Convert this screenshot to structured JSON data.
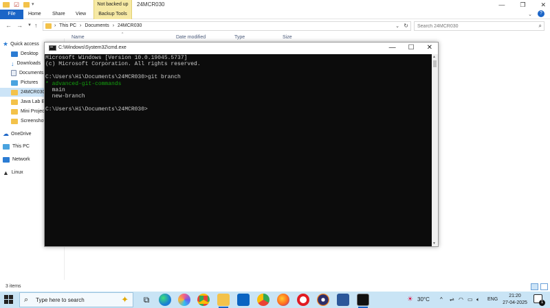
{
  "explorer": {
    "title": "24MCR030",
    "not_backed_up": "Not backed up",
    "ribbon_tabs": {
      "file": "File",
      "home": "Home",
      "share": "Share",
      "view": "View",
      "backup_tools": "Backup Tools"
    },
    "breadcrumb": [
      "This PC",
      "Documents",
      "24MCR030"
    ],
    "search_placeholder": "Search 24MCR030",
    "columns": {
      "name": "Name",
      "date_modified": "Date modified",
      "type": "Type",
      "size": "Size"
    },
    "nav_items": [
      {
        "label": "Quick access",
        "icon": "star-icon",
        "color": "#2b7cd3"
      },
      {
        "label": "Desktop",
        "icon": "desktop-icon",
        "color": "#2b7cd3"
      },
      {
        "label": "Downloads",
        "icon": "download-icon",
        "color": "#2b7cd3"
      },
      {
        "label": "Documents",
        "icon": "document-icon",
        "color": "#7a8aa8"
      },
      {
        "label": "Pictures",
        "icon": "picture-icon",
        "color": "#4aa3df"
      },
      {
        "label": "24MCR030",
        "icon": "folder-icon",
        "color": "#f3c24a"
      },
      {
        "label": "Java Lab Ex",
        "icon": "folder-icon",
        "color": "#f3c24a"
      },
      {
        "label": "Mini Projec",
        "icon": "folder-icon",
        "color": "#f3c24a"
      },
      {
        "label": "Screenshot",
        "icon": "folder-icon",
        "color": "#f3c24a"
      },
      {
        "label": "OneDrive",
        "icon": "cloud-icon",
        "color": "#1b65c7"
      },
      {
        "label": "This PC",
        "icon": "computer-icon",
        "color": "#4aa3df"
      },
      {
        "label": "Network",
        "icon": "network-icon",
        "color": "#2b7cd3"
      },
      {
        "label": "Linux",
        "icon": "penguin-icon",
        "color": "#333333"
      }
    ],
    "status": "3 items"
  },
  "cmd": {
    "title": "C:\\Windows\\System32\\cmd.exe",
    "lines": [
      {
        "text": "Microsoft Windows [Version 10.0.19045.5737]",
        "color": "default"
      },
      {
        "text": "(c) Microsoft Corporation. All rights reserved.",
        "color": "default"
      },
      {
        "text": "",
        "color": "default"
      },
      {
        "text": "C:\\Users\\Hi\\Documents\\24MCR030>git branch",
        "color": "default"
      },
      {
        "text": "* advanced-git-commands",
        "color": "green"
      },
      {
        "text": "  main",
        "color": "default"
      },
      {
        "text": "  new-branch",
        "color": "default"
      },
      {
        "text": "",
        "color": "default"
      },
      {
        "text": "C:\\Users\\Hi\\Documents\\24MCR030>",
        "color": "default"
      }
    ]
  },
  "taskbar": {
    "search_text": "Type here to search",
    "weather": "30°C",
    "language": "ENG",
    "time": "21:20",
    "date": "27-04-2025",
    "notification_count": "1"
  }
}
